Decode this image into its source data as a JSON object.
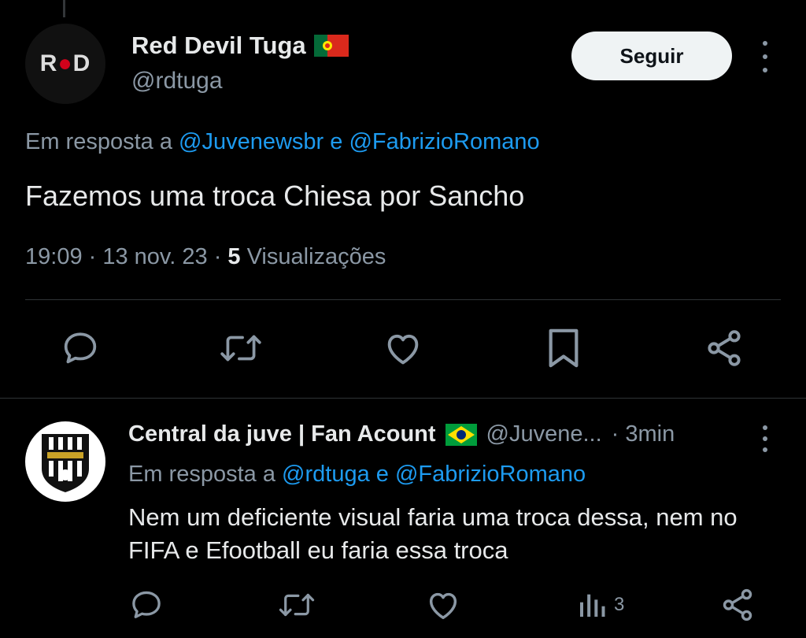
{
  "main_tweet": {
    "avatar_text": "R D",
    "display_name": "Red Devil Tuga",
    "handle": "@rdtuga",
    "follow_label": "Seguir",
    "reply_prefix": "Em resposta a ",
    "reply_mentions": "@Juvenewsbr e @FabrizioRomano",
    "text": "Fazemos uma troca Chiesa por Sancho",
    "timestamp": "19:09 · 13 nov. 23 · ",
    "views_count": "5",
    "views_label": " Visualizações",
    "flag": "portugal-flag-icon"
  },
  "reply_tweet": {
    "display_name": "Central da juve | Fan Acount",
    "handle": "@Juvene...",
    "time": "· 3min",
    "reply_prefix": "Em resposta a ",
    "reply_mentions": "@rdtuga e @FabrizioRomano",
    "text": "Nem um deficiente visual faria uma troca dessa, nem no FIFA e Efootball eu faria essa troca",
    "views_count": "3",
    "flag": "brazil-flag-icon"
  },
  "colors": {
    "background": "#000000",
    "text_primary": "#e7e9ea",
    "text_secondary": "#8b98a5",
    "link": "#1d9bf0",
    "divider": "#2f3336"
  }
}
